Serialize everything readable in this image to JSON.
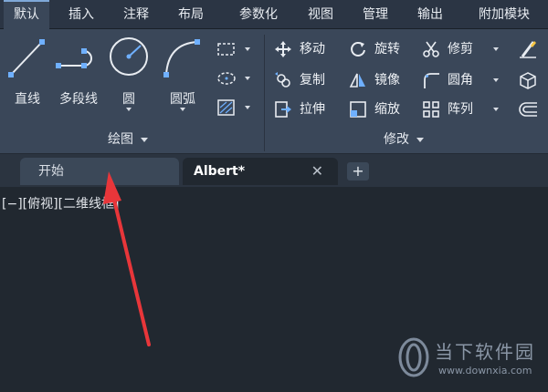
{
  "ribbon": {
    "tabs": [
      "默认",
      "插入",
      "注释",
      "布局",
      "参数化",
      "视图",
      "管理",
      "输出",
      "附加模块"
    ],
    "active_tab_index": 0
  },
  "draw_panel": {
    "title": "绘图",
    "tools": {
      "line": "直线",
      "polyline": "多段线",
      "circle": "圆",
      "arc": "圆弧"
    }
  },
  "modify_panel": {
    "title": "修改",
    "tools": {
      "move": "移动",
      "rotate": "旋转",
      "trim": "修剪",
      "copy": "复制",
      "mirror": "镜像",
      "fillet": "圆角",
      "stretch": "拉伸",
      "scale": "缩放",
      "array": "阵列"
    }
  },
  "file_tabs": {
    "start": "开始",
    "current": "Albert*",
    "close_glyph": "✕",
    "new_tab_glyph": "+"
  },
  "viewport_label": "[−][俯视][二维线框]",
  "watermark": {
    "title": "当下软件园",
    "url": "www.downxia.com"
  },
  "colors": {
    "accent_arrow": "#e8363a",
    "tool_blue": "#6fb0ff",
    "ribbon_bg": "#3a4759",
    "canvas_bg": "#212830"
  }
}
